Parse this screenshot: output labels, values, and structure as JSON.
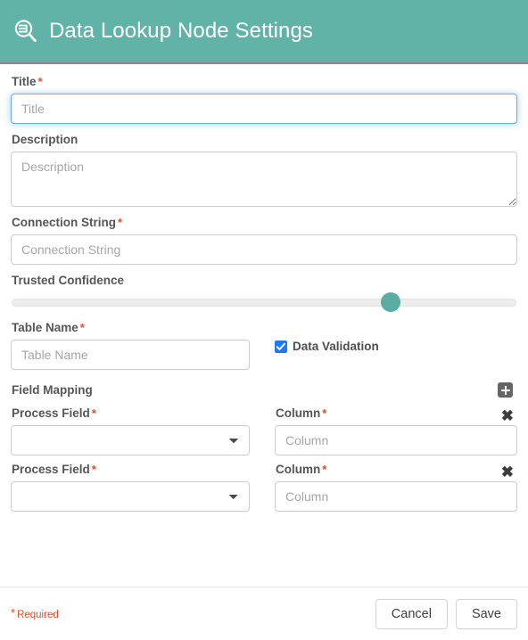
{
  "header": {
    "title": "Data Lookup Node Settings",
    "icon": "search-data-icon",
    "background_color": "#61b3a8",
    "text_color": "#ffffff"
  },
  "form": {
    "title_field": {
      "label": "Title",
      "required_marker": "*",
      "placeholder": "Title",
      "value": "",
      "focused": true
    },
    "description_field": {
      "label": "Description",
      "placeholder": "Description",
      "value": ""
    },
    "connection_string_field": {
      "label": "Connection String",
      "required_marker": "*",
      "placeholder": "Connection String",
      "value": ""
    },
    "trusted_confidence": {
      "label": "Trusted Confidence",
      "value": 75,
      "min": 0,
      "max": 100,
      "thumb_color": "#5aada2",
      "track_color": "#ededed"
    },
    "table_name_field": {
      "label": "Table Name",
      "required_marker": "*",
      "placeholder": "Table Name",
      "value": ""
    },
    "data_validation": {
      "label": "Data Validation",
      "checked": true,
      "checkbox_color": "#2079f5"
    },
    "field_mapping": {
      "label": "Field Mapping",
      "add_icon": "plus-square-icon",
      "remove_icon": "close-x-icon",
      "rows": [
        {
          "process_field": {
            "label": "Process Field",
            "required_marker": "*",
            "selected": "",
            "options": [
              ""
            ]
          },
          "column": {
            "label": "Column",
            "required_marker": "*",
            "placeholder": "Column",
            "value": ""
          }
        },
        {
          "process_field": {
            "label": "Process Field",
            "required_marker": "*",
            "selected": "",
            "options": [
              ""
            ]
          },
          "column": {
            "label": "Column",
            "required_marker": "*",
            "placeholder": "Column",
            "value": ""
          }
        }
      ]
    }
  },
  "footer": {
    "required_star": "*",
    "required_note": "Required",
    "required_color": "#e8492a",
    "cancel_label": "Cancel",
    "save_label": "Save"
  }
}
